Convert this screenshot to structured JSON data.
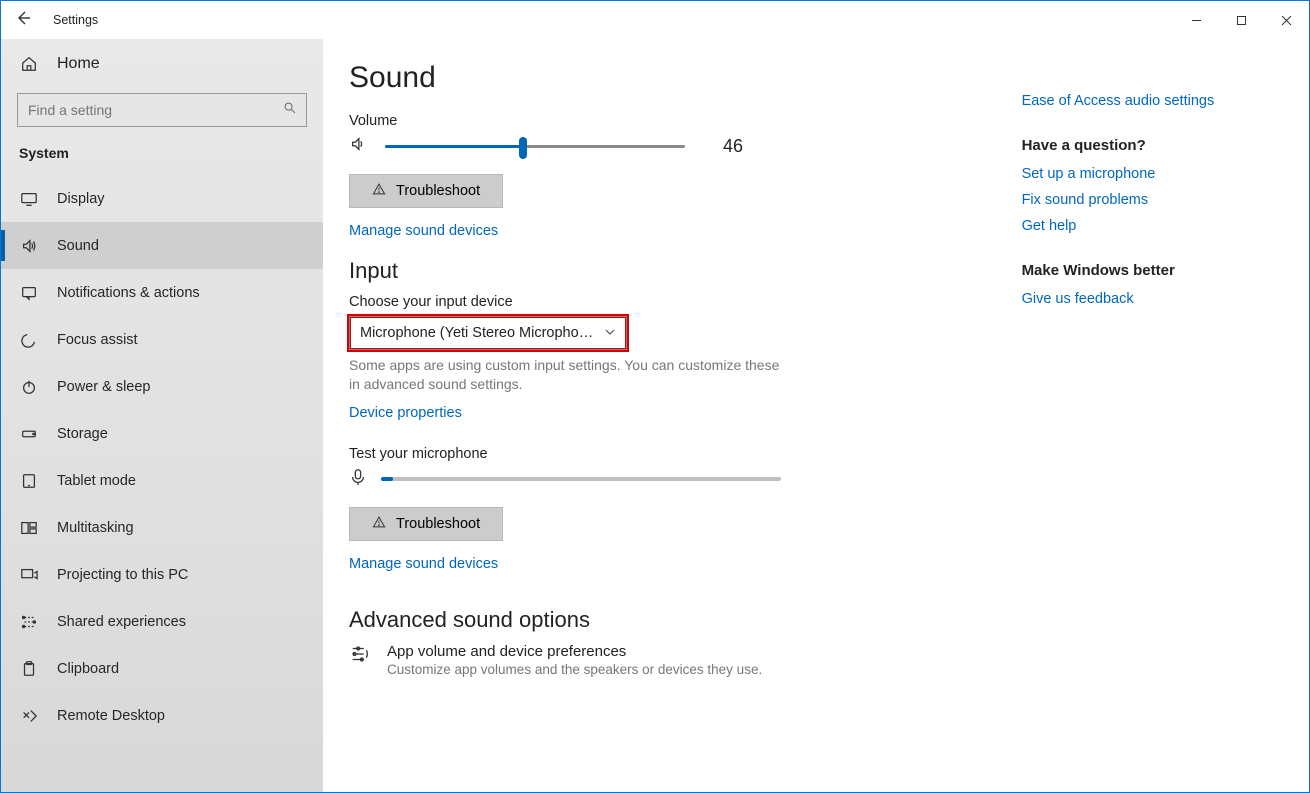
{
  "titlebar": {
    "title": "Settings"
  },
  "sidebar": {
    "home": "Home",
    "search_placeholder": "Find a setting",
    "category": "System",
    "items": [
      {
        "label": "Display"
      },
      {
        "label": "Sound"
      },
      {
        "label": "Notifications & actions"
      },
      {
        "label": "Focus assist"
      },
      {
        "label": "Power & sleep"
      },
      {
        "label": "Storage"
      },
      {
        "label": "Tablet mode"
      },
      {
        "label": "Multitasking"
      },
      {
        "label": "Projecting to this PC"
      },
      {
        "label": "Shared experiences"
      },
      {
        "label": "Clipboard"
      },
      {
        "label": "Remote Desktop"
      }
    ]
  },
  "main": {
    "page_title": "Sound",
    "volume_label": "Volume",
    "volume_value": "46",
    "volume_percent": 46,
    "troubleshoot": "Troubleshoot",
    "manage_devices": "Manage sound devices",
    "input_heading": "Input",
    "choose_input": "Choose your input device",
    "input_selected": "Microphone (Yeti Stereo Micropho…",
    "input_note": "Some apps are using custom input settings. You can customize these in advanced sound settings.",
    "device_properties": "Device properties",
    "test_mic": "Test your microphone",
    "manage_devices2": "Manage sound devices",
    "advanced_heading": "Advanced sound options",
    "adv_app": {
      "title": "App volume and device preferences",
      "sub": "Customize app volumes and the speakers or devices they use."
    }
  },
  "right": {
    "ease": "Ease of Access audio settings",
    "q_head": "Have a question?",
    "q_links": [
      "Set up a microphone",
      "Fix sound problems",
      "Get help"
    ],
    "better_head": "Make Windows better",
    "feedback": "Give us feedback"
  }
}
